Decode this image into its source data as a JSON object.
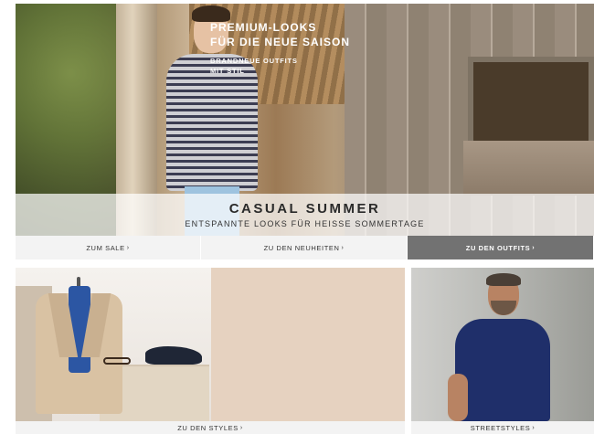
{
  "hero": {
    "title": "CASUAL SUMMER",
    "subtitle": "ENTSPANNTE LOOKS FÜR HEISSE SOMMERTAGE"
  },
  "nav": [
    {
      "label": "ZUM SALE",
      "active": false
    },
    {
      "label": "ZU DEN NEUHEITEN",
      "active": false
    },
    {
      "label": "ZU DEN OUTFITS",
      "active": true
    }
  ],
  "chevron": "›",
  "promo_left": {
    "title_line1": "PREMIUM-LOOKS",
    "title_line2": "FÜR DIE NEUE SAISON",
    "subtitle_line1": "BRANDNEUE OUTFITS",
    "subtitle_line2": "MIT STIL",
    "link_label": "ZU DEN STYLES"
  },
  "promo_right": {
    "link_label": "STREETSTYLES"
  },
  "colors": {
    "active_nav": "#727272",
    "nav_bg": "#f3f3f3",
    "promo_panel": "#e6d2c0"
  }
}
